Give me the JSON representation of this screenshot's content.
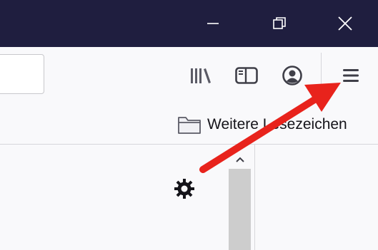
{
  "window_controls": {
    "minimize_icon": "minimize-icon",
    "restore_icon": "restore-icon",
    "close_icon": "close-icon"
  },
  "toolbar": {
    "icons": [
      "library-icon",
      "sidebar-icon",
      "account-icon",
      "hamburger-menu-icon"
    ]
  },
  "bookmarks_bar": {
    "other_bookmarks_label": "Weitere Lesezeichen",
    "icon": "folder-icon"
  },
  "content": {
    "settings_icon": "gear-icon"
  },
  "annotation": {
    "color": "#e8231c",
    "points_to": "hamburger-menu-icon"
  },
  "colors": {
    "titlebar": "#1f1e3f",
    "toolbar_bg": "#f9f9fb",
    "icon": "#5b5b66"
  }
}
